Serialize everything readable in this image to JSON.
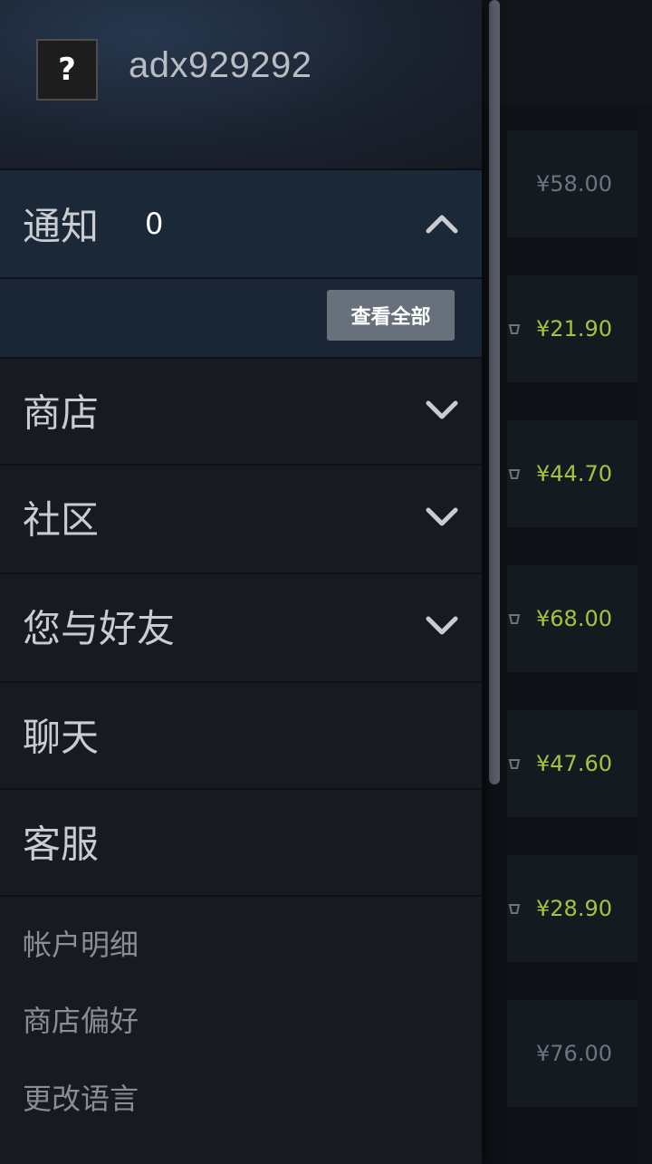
{
  "background_page": {
    "prices": [
      {
        "text": "¥58.00",
        "sale": false
      },
      {
        "text": "¥21.90",
        "sale": true
      },
      {
        "text": "¥44.70",
        "sale": true
      },
      {
        "text": "¥68.00",
        "sale": true
      },
      {
        "text": "¥47.60",
        "sale": true
      },
      {
        "text": "¥28.90",
        "sale": true
      },
      {
        "text": "¥76.00",
        "sale": false
      }
    ]
  },
  "drawer": {
    "avatar": {
      "glyph": "?"
    },
    "username": "adx929292",
    "notifications": {
      "label": "通知",
      "count": "0",
      "expanded": true,
      "view_all_label": "查看全部"
    },
    "menu": [
      {
        "label": "商店",
        "icon": "chevron-down-icon"
      },
      {
        "label": "社区",
        "icon": "chevron-down-icon"
      },
      {
        "label": "您与好友",
        "icon": "chevron-down-icon"
      },
      {
        "label": "聊天"
      },
      {
        "label": "客服"
      }
    ],
    "sub_links": [
      {
        "label": "帐户明细"
      },
      {
        "label": "商店偏好"
      },
      {
        "label": "更改语言"
      }
    ]
  },
  "colors": {
    "drawer_bg": "#171a21",
    "notif_bg": "#1b2838",
    "sale_price": "#a4c53a",
    "button_bg": "#67707b"
  }
}
